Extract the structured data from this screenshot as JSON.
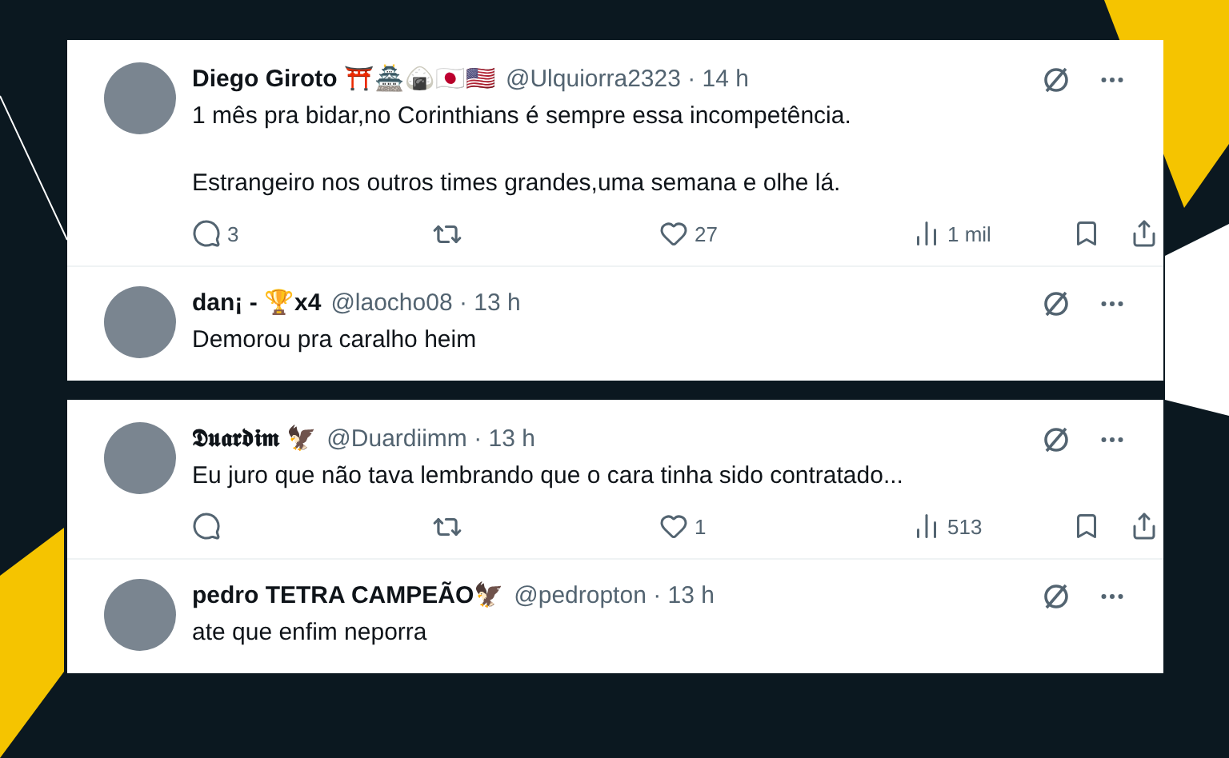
{
  "cards": [
    {
      "tweets": [
        {
          "author": "Diego Giroto ⛩️🏯🍙🇯🇵🇺🇸",
          "handle": "@Ulquiorra2323 · 14 h",
          "paragraphs": [
            "1 mês pra bidar,no Corinthians é sempre essa incompetência.",
            "Estrangeiro nos outros times grandes,uma semana e olhe lá."
          ],
          "stats": {
            "replies": "3",
            "likes": "27",
            "views": "1 mil"
          }
        },
        {
          "author": "dan¡ - 🏆x4",
          "handle": "@laocho08 · 13 h",
          "paragraphs": [
            "Demorou pra caralho heim"
          ]
        }
      ]
    },
    {
      "tweets": [
        {
          "author": "𝕯𝖚𝖆𝖗𝖉𝖎𝖒 🦅",
          "handle": "@Duardiimm · 13 h",
          "paragraphs": [
            "Eu juro que não tava lembrando que o cara tinha sido contratado..."
          ],
          "stats": {
            "likes": "1",
            "views": "513"
          }
        },
        {
          "author": "pedro TETRA CAMPEÃO🦅",
          "handle": "@pedropton · 13 h",
          "paragraphs": [
            "ate que enfim neporra"
          ]
        }
      ]
    }
  ]
}
